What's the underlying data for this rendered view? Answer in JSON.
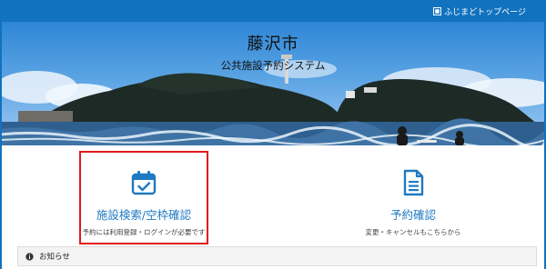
{
  "header": {
    "top_link_label": "ふじまどトップページ",
    "top_link_icon": "square-icon",
    "bar_color": "#1172bf"
  },
  "hero": {
    "city_name": "藤沢市",
    "system_name": "公共施設予約システム"
  },
  "cards": [
    {
      "icon": "calendar-check-icon",
      "title": "施設検索/空枠確認",
      "note": "予約には利用登録・ログインが必要です"
    },
    {
      "icon": "document-icon",
      "title": "予約確認",
      "note": "変更・キャンセルもこちらから"
    }
  ],
  "notice": {
    "icon": "info-circle-icon",
    "label": "お知らせ"
  },
  "colors": {
    "accent": "#1e79c2",
    "highlight": "#e0191e"
  }
}
